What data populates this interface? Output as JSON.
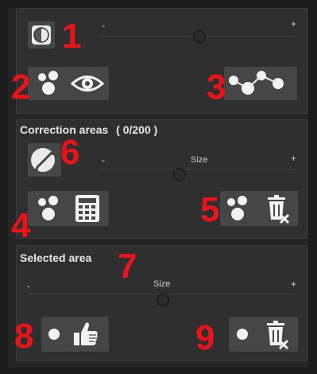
{
  "panel_top": {
    "slider": {
      "min_label": "-",
      "max_label": "+"
    }
  },
  "panel_correction": {
    "title": "Correction areas",
    "count": "( 0/200 )",
    "slider": {
      "label": "Size",
      "min_label": "-",
      "max_label": "+"
    }
  },
  "panel_selected": {
    "title": "Selected area",
    "slider": {
      "label": "Size",
      "min_label": "-",
      "max_label": "+"
    }
  },
  "callouts": [
    "1",
    "2",
    "3",
    "4",
    "5",
    "6",
    "7",
    "8",
    "9"
  ],
  "colors": {
    "callout": "#e8141a",
    "panel": "#2f2f2f",
    "tile": "#464646"
  },
  "icons": [
    "contrast-icon",
    "dots-icon",
    "eye-icon",
    "connected-dots-icon",
    "brush-icon",
    "calculator-icon",
    "trash-icon",
    "thumbs-up-icon"
  ]
}
